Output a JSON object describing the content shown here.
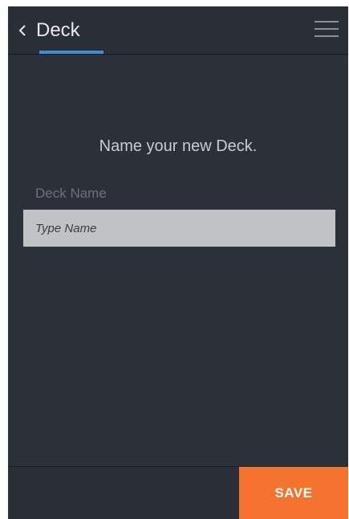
{
  "header": {
    "back_icon": "chevron-left-icon",
    "title": "Deck",
    "menu_icon": "hamburger-menu-icon",
    "active_tab_color": "#3e90cf"
  },
  "main": {
    "prompt": "Name your new Deck.",
    "deck_name_label": "Deck Name",
    "deck_name_input": {
      "value": "",
      "placeholder": "Type Name"
    }
  },
  "footer": {
    "save_label": "SAVE",
    "save_color": "#f4732f"
  }
}
